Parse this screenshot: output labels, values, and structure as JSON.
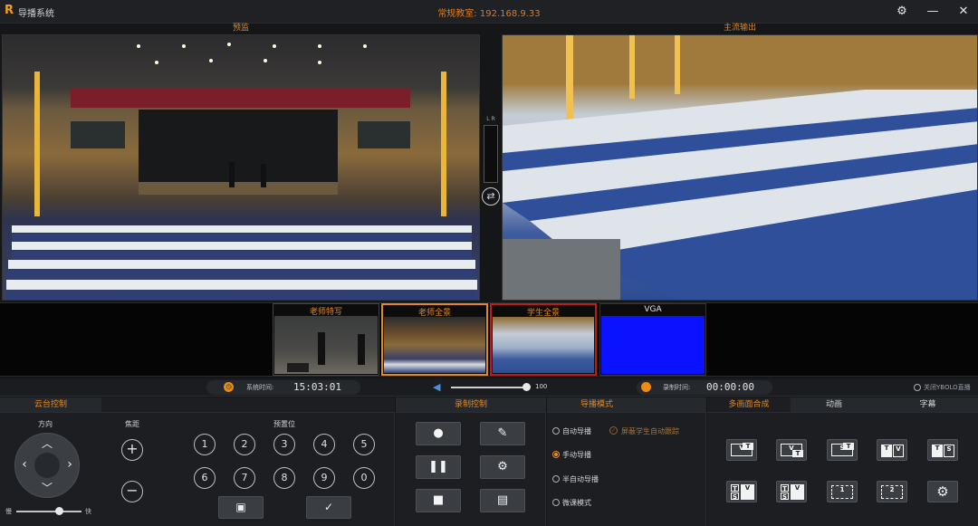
{
  "app": {
    "logo": "R",
    "title": "导播系统",
    "room": "常规教室: 192.168.9.33"
  },
  "window": {
    "settings": "⚙",
    "minimize": "—",
    "close": "✕"
  },
  "monitors": {
    "preview_label": "预监",
    "output_label": "主流输出",
    "level_label": "L R"
  },
  "sources": [
    {
      "label": "老师特写"
    },
    {
      "label": "老师全景"
    },
    {
      "label": "学生全景"
    },
    {
      "label": "VGA"
    }
  ],
  "status": {
    "system_time_label": "系统时间:",
    "system_time": "15:03:01",
    "volume": "100",
    "record_time_label": "录制时间:",
    "record_time": "00:00:00",
    "bolo_label": "关闭YBOLO直播"
  },
  "ptz": {
    "title": "云台控制",
    "direction_label": "方向",
    "focus_label": "焦距",
    "preset_label": "预置位",
    "presets_row1": [
      "1",
      "2",
      "3",
      "4",
      "5"
    ],
    "presets_row2": [
      "6",
      "7",
      "8",
      "9",
      "0"
    ],
    "slow_label": "慢",
    "fast_label": "快",
    "speed": 0.7
  },
  "record": {
    "title": "录制控制"
  },
  "mode": {
    "title": "导播模式",
    "auto": "自动导播",
    "shield": "屏蔽学生自动跟踪",
    "manual": "手动导播",
    "semi": "半自动导播",
    "micro": "微课模式"
  },
  "compose": {
    "tabs": [
      "多画面合成",
      "动画",
      "字幕"
    ]
  }
}
